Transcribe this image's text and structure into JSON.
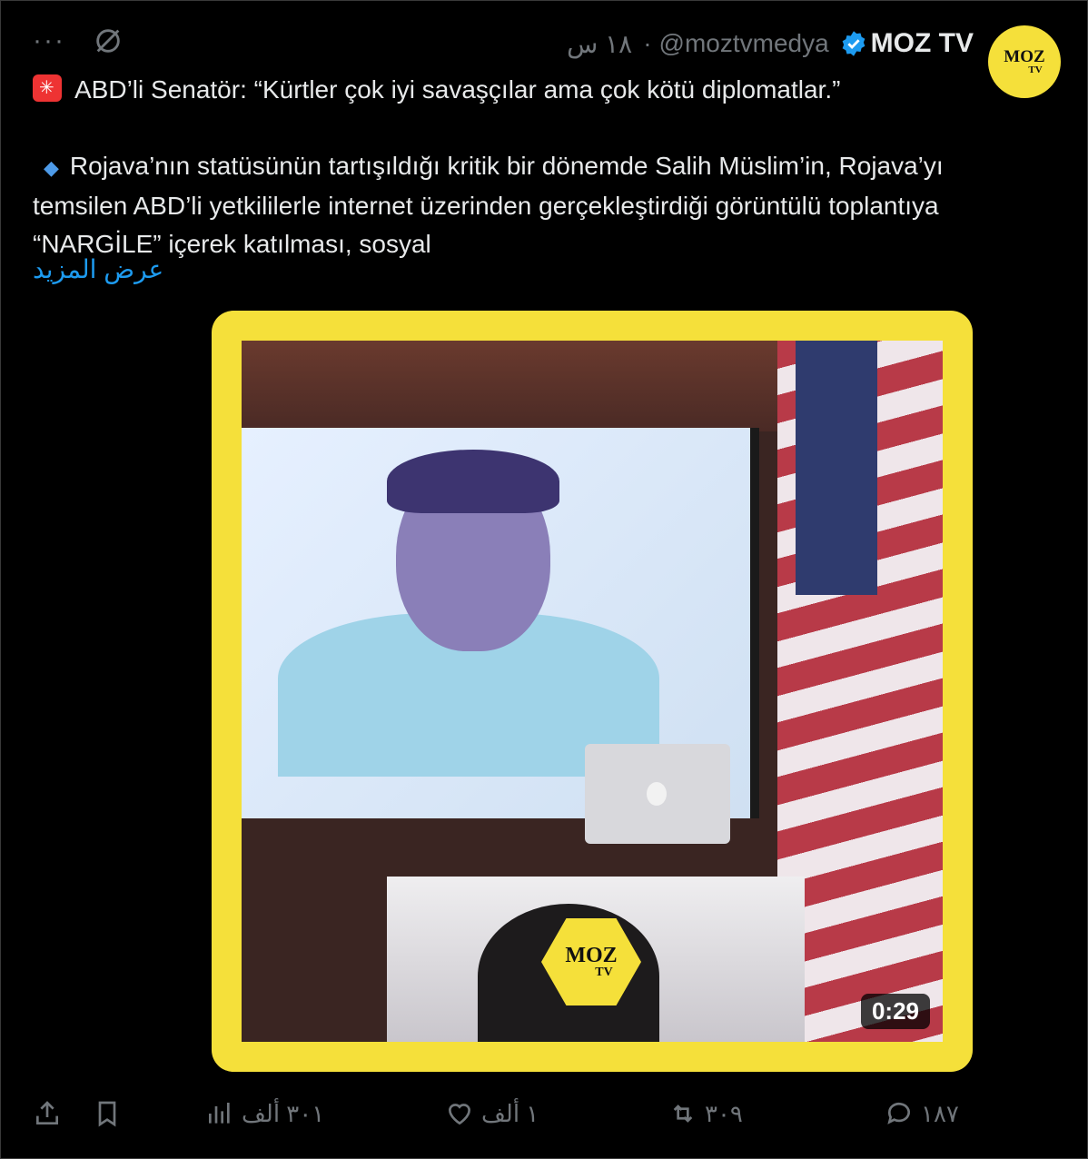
{
  "header": {
    "display_name": "MOZ TV",
    "handle": "@moztvmedya",
    "separator": "·",
    "time": "١٨ س",
    "avatar": {
      "line1": "MOZ",
      "line2": "TV"
    }
  },
  "tweet": {
    "line1": "ABD’li Senatör: “Kürtler çok iyi savaşçılar ama çok kötü diplomatlar.”",
    "paragraph2": "Rojava’nın statüsünün tartışıldığı kritik bir dönemde Salih Müslim’in, Rojava’yı temsilen ABD’li yetkililerle internet üzerinden gerçekleştirdiği görüntülü toplantıya “NARGİLE” içerek katılması, sosyal",
    "show_more": "عرض المزيد"
  },
  "media": {
    "duration": "0:29",
    "watermark": {
      "line1": "MOZ",
      "line2": "TV"
    }
  },
  "actions": {
    "replies": "١٨٧",
    "reposts": "٣٠٩",
    "likes": "١ ألف",
    "views": "٣٠١ ألف"
  },
  "icons": [
    "more-icon",
    "grok-icon",
    "verified-icon",
    "siren-icon",
    "diamond-icon",
    "reply-icon",
    "repost-icon",
    "like-icon",
    "views-icon",
    "bookmark-icon",
    "share-icon"
  ],
  "colors": {
    "accent": "#1d9bf0",
    "brand_yellow": "#f5e03a",
    "muted": "#71767b"
  }
}
